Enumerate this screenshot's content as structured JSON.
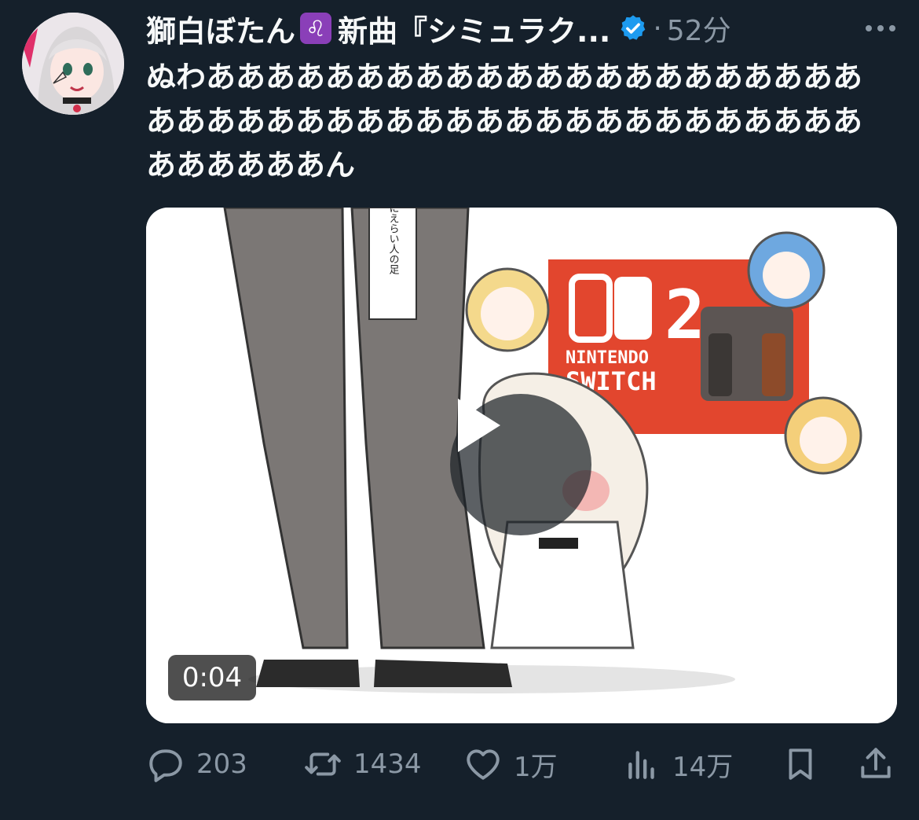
{
  "tweet": {
    "display_name": "獅白ぼたん",
    "name_suffix": "新曲『シミュラク...",
    "zodiac_glyph": "♌",
    "separator": "·",
    "time_ago": "52分",
    "text": "ぬわああああああああああああああああああああああああああああああああああああああああああああああああああああん",
    "media": {
      "duration": "0:04",
      "in_image_text": {
        "sign": "圧倒的にえらい人の足",
        "logo_number": "2",
        "logo_line1": "NINTENDO",
        "logo_line2": "SWITCH"
      }
    },
    "actions": {
      "replies": "203",
      "retweets": "1434",
      "likes": "1万",
      "views": "14万"
    }
  },
  "colors": {
    "background": "#15202b",
    "text": "#f7f9f9",
    "secondary_text": "#8b98a5",
    "verified": "#1d9bf0",
    "logo_red": "#e2462e"
  },
  "icons": {
    "more": "more-icon",
    "verified": "verified-badge-icon",
    "reply": "reply-icon",
    "retweet": "retweet-icon",
    "like": "like-icon",
    "views": "views-icon",
    "bookmark": "bookmark-icon",
    "share": "share-icon",
    "play": "play-icon"
  }
}
